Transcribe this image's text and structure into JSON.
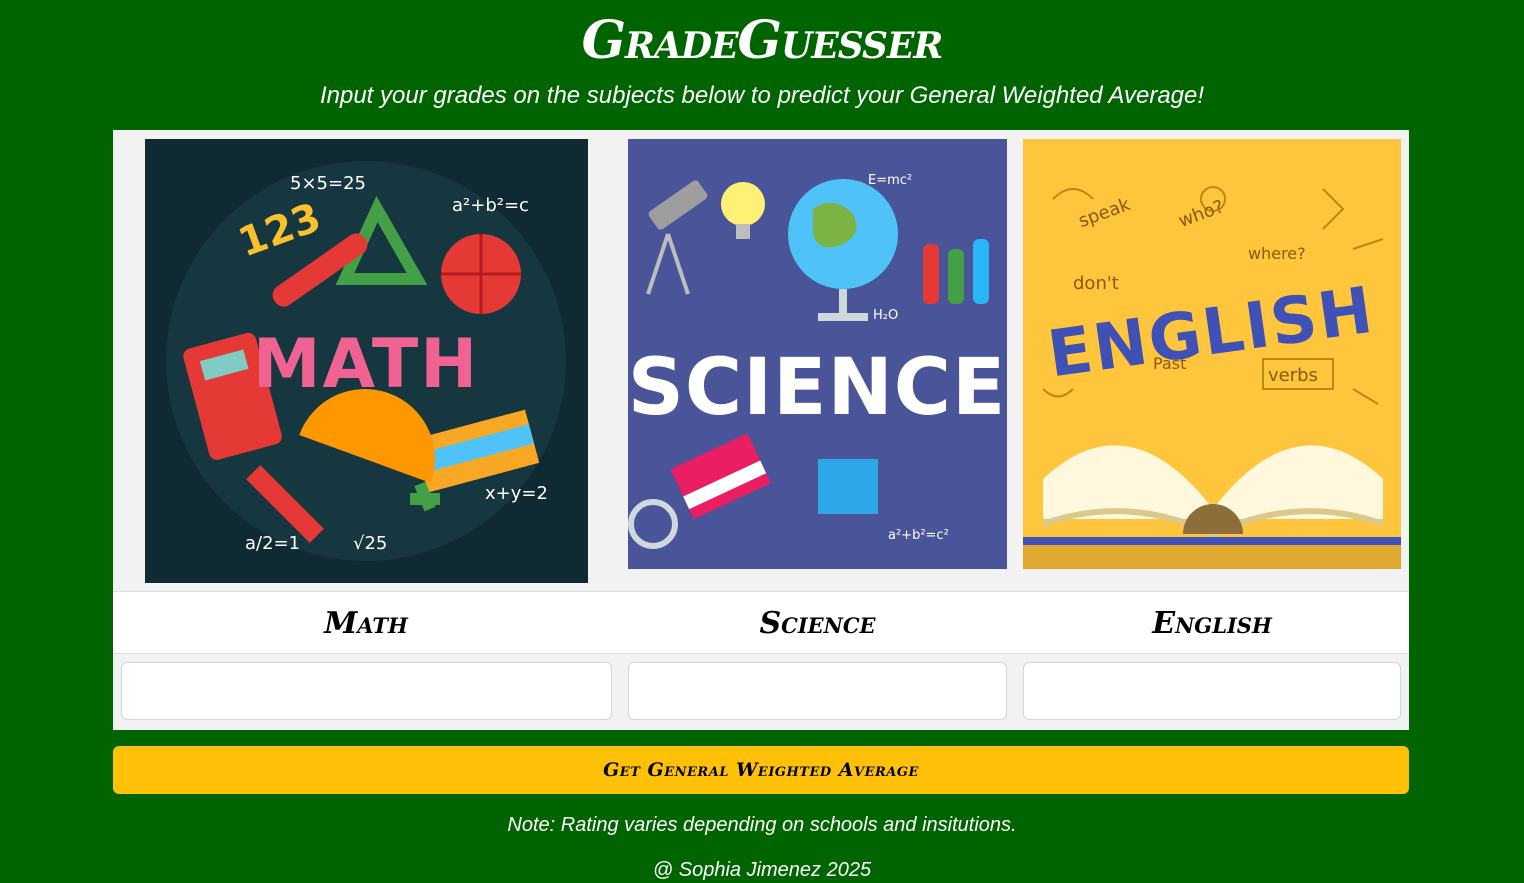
{
  "header": {
    "title": "GradeGuesser",
    "subtitle": "Input your grades on the subjects below to predict your General Weighted Average!"
  },
  "subjects": [
    {
      "label": "Math",
      "image_text": "MATH",
      "input_value": "",
      "input_placeholder": ""
    },
    {
      "label": "Science",
      "image_text": "SCIENCE",
      "input_value": "",
      "input_placeholder": ""
    },
    {
      "label": "English",
      "image_text": "ENGLISH",
      "input_value": "",
      "input_placeholder": ""
    }
  ],
  "action": {
    "button_label": "Get General Weighted Average"
  },
  "footer": {
    "note": "Note: Rating varies depending on schools and insitutions.",
    "credit": "@ Sophia Jimenez 2025"
  },
  "colors": {
    "page_background": "#006400",
    "panel_background": "#f2f2f2",
    "button": "#ffc107",
    "math_image_bg": "#0f2a33",
    "science_image_bg": "#4a5599",
    "english_image_bg": "#ffc53d"
  },
  "icons": [
    "math-illustration",
    "science-illustration",
    "english-illustration"
  ]
}
